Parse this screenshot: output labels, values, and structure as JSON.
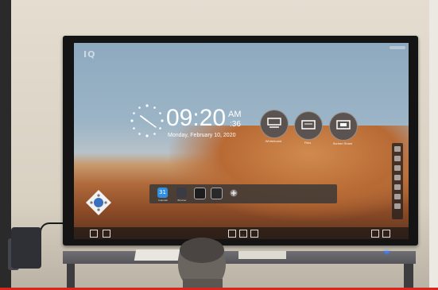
{
  "screen": {
    "brand_mark": "IQ",
    "time": "09:20",
    "ampm": "AM",
    "seconds": ":36",
    "date": "Monday, February 10, 2020",
    "tiles": [
      {
        "icon": "whiteboard-icon",
        "label": "Whiteboard"
      },
      {
        "icon": "files-icon",
        "label": "Files"
      },
      {
        "icon": "screen-share-icon",
        "label": "Screen Share"
      }
    ],
    "dock": [
      {
        "icon": "calendar-icon",
        "label": "Calendar",
        "color": "#2f8fe0"
      },
      {
        "icon": "browser-icon",
        "label": "Browser",
        "color": "#3b3b46"
      },
      {
        "icon": "camera-icon",
        "label": "",
        "color": "#1d1d1d"
      },
      {
        "icon": "settings-icon",
        "label": "",
        "color": "#2a2a2a"
      },
      {
        "icon": "add-icon",
        "label": "",
        "color": "transparent"
      }
    ],
    "calendar_day": "31"
  },
  "colors": {
    "bezel": "#141414",
    "sky": "#9bb4c6",
    "dune": "#b86a34",
    "tile": "#5b5350",
    "youtube_red": "#d7261e",
    "status_led": "#3a7dff"
  }
}
